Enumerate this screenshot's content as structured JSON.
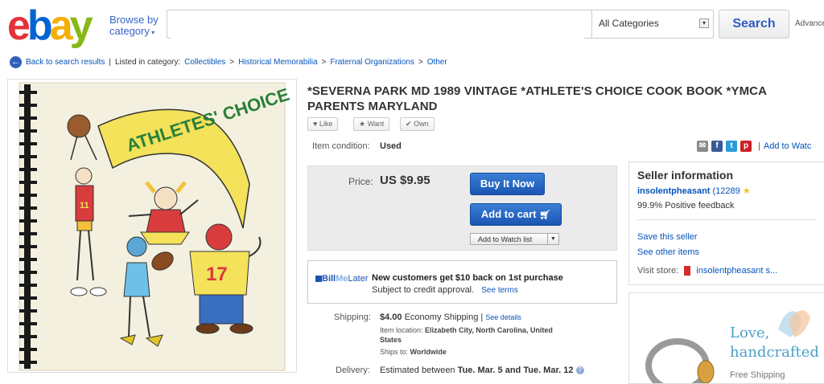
{
  "header": {
    "logo_letters": [
      "e",
      "b",
      "a",
      "y"
    ],
    "logo_colors": [
      "#e53238",
      "#0064d2",
      "#f5af02",
      "#86b817"
    ],
    "browse_line1": "Browse by",
    "browse_line2": "category",
    "search_placeholder": "",
    "category_value": "All Categories",
    "search_label": "Search",
    "advanced_label": "Advance"
  },
  "breadcrumb": {
    "back": "Back to search results",
    "listed": "Listed in category:",
    "items": [
      "Collectibles",
      "Historical Memorabilia",
      "Fraternal Organizations",
      "Other"
    ],
    "sep": ">"
  },
  "photo": {
    "banner": "ATHLETES' CHOICE",
    "jersey_number": "17",
    "small_number": "11"
  },
  "item": {
    "title": "*SEVERNA PARK MD 1989 VINTAGE *ATHLETE'S CHOICE COOK BOOK *YMCA PARENTS MARYLAND",
    "like": "Like",
    "want": "Want",
    "own": "Own",
    "condition_label": "Item condition:",
    "condition_value": "Used",
    "add_to_watch_top": "Add to Watc",
    "price_label": "Price:",
    "price_value": "US $9.95",
    "buy_now": "Buy It Now",
    "add_to_cart": "Add to cart",
    "add_to_watch": "Add to Watch list"
  },
  "billmelater": {
    "brand1": "Bill",
    "brand2": "Me",
    "brand3": "Later",
    "headline": "New customers get $10 back on 1st purchase",
    "sub": "Subject to credit approval.",
    "see_terms": "See terms"
  },
  "shipping": {
    "label": "Shipping:",
    "cost": "$4.00",
    "method": "Economy Shipping |",
    "see_details": "See details",
    "location_label": "Item location:",
    "location_value": "Elizabeth City, North Carolina, United",
    "location_value2": "States",
    "ships_to_label": "Ships to:",
    "ships_to_value": "Worldwide",
    "delivery_label": "Delivery:",
    "delivery_pre": "Estimated between",
    "delivery_range": "Tue. Mar. 5 and Tue. Mar. 12"
  },
  "seller": {
    "heading": "Seller information",
    "name": "insolentpheasant",
    "score": "(12289",
    "feedback": "99.9% Positive feedback",
    "save": "Save this seller",
    "other": "See other items",
    "store_label": "Visit store:",
    "store_name": "insolentpheasant s..."
  },
  "ad": {
    "line1": "Love,",
    "line2": "handcrafted",
    "line3": "Free Shipping"
  },
  "colors": {
    "link": "#0654ba",
    "accent_blue": "#1b55b3"
  }
}
